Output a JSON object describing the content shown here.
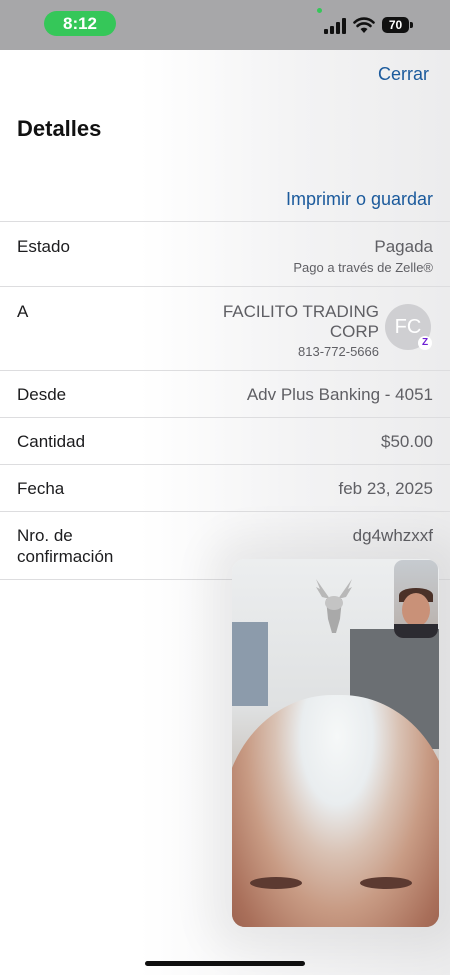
{
  "status_bar": {
    "time": "8:12",
    "battery_level": "70",
    "signal_icon": "cellular-signal-icon",
    "wifi_icon": "wifi-icon"
  },
  "header": {
    "close_label": "Cerrar",
    "title": "Detalles",
    "print_label": "Imprimir o guardar"
  },
  "details": {
    "status": {
      "label": "Estado",
      "value": "Pagada",
      "sub": "Pago a través de Zelle®"
    },
    "recipient": {
      "label": "A",
      "name_line1": "FACILITO TRADING",
      "name_line2": "CORP",
      "phone": "813-772-5666",
      "avatar_initials": "FC",
      "badge": "Z"
    },
    "from": {
      "label": "Desde",
      "value": "Adv Plus Banking - 4051"
    },
    "amount": {
      "label": "Cantidad",
      "value": "$50.00"
    },
    "date": {
      "label": "Fecha",
      "value": "feb 23, 2025"
    },
    "confirmation": {
      "label_line1": "Nro. de",
      "label_line2": "confirmación",
      "value": "dg4whzxxf"
    }
  },
  "colors": {
    "accent": "#1b5a9c",
    "status_pill": "#35c759"
  }
}
